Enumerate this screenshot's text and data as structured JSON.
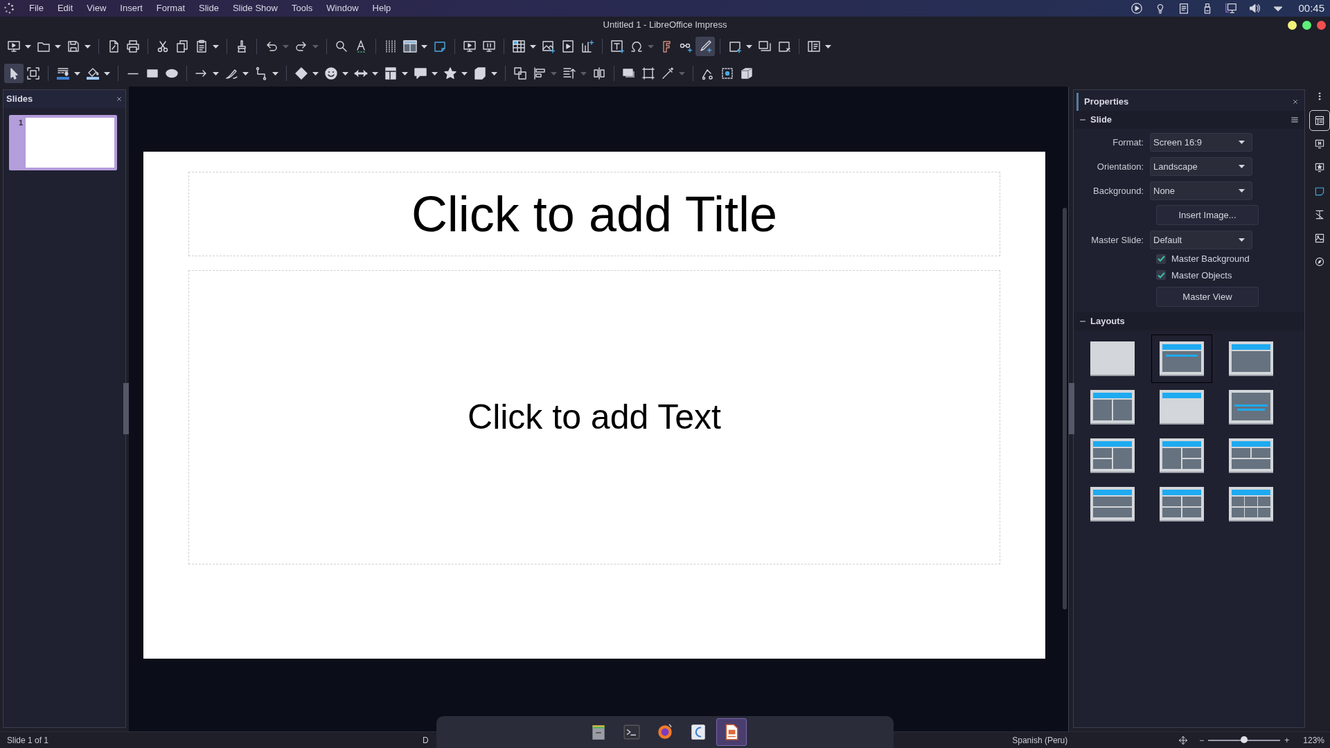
{
  "system_bar": {
    "menu": [
      "File",
      "Edit",
      "View",
      "Insert",
      "Format",
      "Slide",
      "Slide Show",
      "Tools",
      "Window",
      "Help"
    ],
    "clock": "00:45"
  },
  "window": {
    "title": "Untitled 1 - LibreOffice Impress"
  },
  "toolbar_1": [
    {
      "selected": false
    },
    {
      "selected": false
    },
    {
      "selected": false
    },
    {
      "selected": false
    },
    {
      "selected": false
    },
    {
      "selected": false
    },
    {
      "selected": false
    },
    {
      "selected": false
    },
    {
      "selected": false
    },
    {
      "selected": false
    },
    {
      "selected": false
    },
    {
      "selected": false
    },
    {
      "selected": false
    },
    {
      "selected": false
    },
    {
      "selected": false
    },
    {
      "selected": false
    },
    {
      "selected": false
    },
    {
      "selected": false
    },
    {
      "selected": false
    },
    {
      "selected": false
    },
    {
      "selected": false
    },
    {
      "selected": false
    },
    {
      "selected": false
    },
    {
      "selected": false
    },
    {
      "selected": false
    },
    {
      "selected": false
    },
    {
      "selected": true
    },
    {
      "selected": false
    },
    {
      "selected": false
    },
    {
      "selected": false
    },
    {
      "selected": false
    }
  ],
  "toolbar_2": [
    {
      "selected": true
    },
    {
      "selected": false
    },
    {
      "selected": false
    },
    {
      "selected": false
    },
    {
      "selected": false
    },
    {
      "selected": false
    },
    {
      "selected": false
    },
    {
      "selected": false
    },
    {
      "selected": false
    },
    {
      "selected": false
    },
    {
      "selected": false
    },
    {
      "selected": false
    },
    {
      "selected": false
    },
    {
      "selected": false
    },
    {
      "selected": false
    },
    {
      "selected": false
    },
    {
      "selected": false
    },
    {
      "selected": false
    },
    {
      "selected": false
    },
    {
      "selected": false
    },
    {
      "selected": false
    },
    {
      "selected": false
    },
    {
      "selected": false
    },
    {
      "selected": false
    },
    {
      "selected": false
    },
    {
      "selected": false
    },
    {
      "selected": false
    }
  ],
  "slides_panel": {
    "title": "Slides",
    "slides": [
      {
        "number": "1",
        "selected": true
      }
    ]
  },
  "slide": {
    "title_placeholder": "Click to add Title",
    "text_placeholder": "Click to add Text"
  },
  "properties": {
    "title": "Properties",
    "slide_section": {
      "title": "Slide",
      "fields": [
        {
          "kind": "dropdown",
          "label": "Format:",
          "value": "Screen 16:9"
        },
        {
          "kind": "dropdown",
          "label": "Orientation:",
          "value": "Landscape"
        },
        {
          "kind": "dropdown",
          "label": "Background:",
          "value": "None"
        },
        {
          "kind": "button",
          "label": "Insert Image..."
        },
        {
          "kind": "dropdown",
          "label": "Master Slide:",
          "value": "Default"
        },
        {
          "kind": "checkbox",
          "label": "Master Background",
          "checked": true
        },
        {
          "kind": "checkbox",
          "label": "Master Objects",
          "checked": true
        },
        {
          "kind": "button",
          "label": "Master View"
        }
      ]
    },
    "layouts_section": {
      "title": "Layouts",
      "layouts": [
        {
          "kind": "blank",
          "selected": false
        },
        {
          "kind": "title-subtitle",
          "selected": true
        },
        {
          "kind": "title-content",
          "selected": false
        },
        {
          "kind": "title-two-content",
          "selected": false
        },
        {
          "kind": "title-only",
          "selected": false
        },
        {
          "kind": "centered-text",
          "selected": false
        },
        {
          "kind": "title-2content-content",
          "selected": false
        },
        {
          "kind": "title-content-2content",
          "selected": false
        },
        {
          "kind": "title-2content-over-content",
          "selected": false
        },
        {
          "kind": "title-content-over-content",
          "selected": false
        },
        {
          "kind": "title-4content",
          "selected": false
        },
        {
          "kind": "title-6content",
          "selected": false
        }
      ]
    }
  },
  "sidebar_tabs": [
    {
      "selected": true
    },
    {
      "selected": false
    },
    {
      "selected": false
    },
    {
      "selected": false
    },
    {
      "selected": false
    },
    {
      "selected": false
    },
    {
      "selected": false
    }
  ],
  "status_bar": {
    "slide_info": "Slide 1 of 1",
    "field_2": "D",
    "language": "Spanish (Peru)",
    "zoom_out": "−",
    "zoom": {
      "level": 0.5
    },
    "zoom_in": "+",
    "zoom_reading": "123%"
  },
  "dock": [
    {
      "selected": false
    },
    {
      "selected": false
    },
    {
      "selected": false
    },
    {
      "selected": false
    },
    {
      "selected": true
    }
  ]
}
